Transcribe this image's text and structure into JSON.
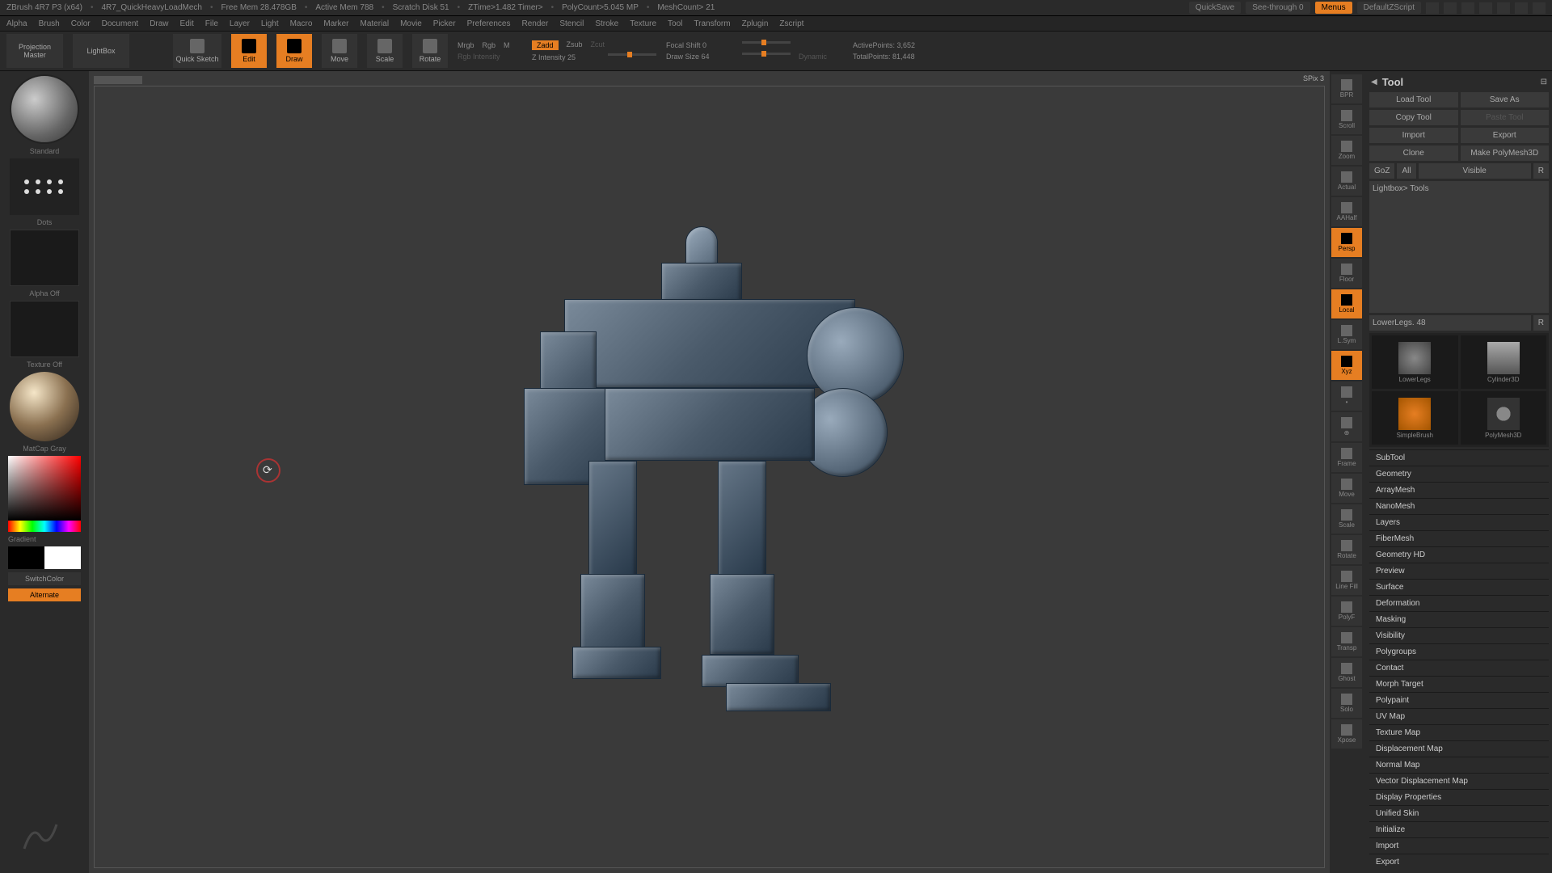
{
  "titlebar": {
    "app": "ZBrush 4R7 P3 (x64)",
    "doc": "4R7_QuickHeavyLoadMech",
    "stats": [
      "Free Mem 28.478GB",
      "Active Mem 788",
      "Scratch Disk 51",
      "ZTime>1.482 Timer>",
      "PolyCount>5.045 MP",
      "MeshCount> 21"
    ],
    "quicksave": "QuickSave",
    "seethrough": "See-through   0",
    "menus": "Menus",
    "script": "DefaultZScript"
  },
  "menus": [
    "Alpha",
    "Brush",
    "Color",
    "Document",
    "Draw",
    "Edit",
    "File",
    "Layer",
    "Light",
    "Macro",
    "Marker",
    "Material",
    "Movie",
    "Picker",
    "Preferences",
    "Render",
    "Stencil",
    "Stroke",
    "Texture",
    "Tool",
    "Transform",
    "Zplugin",
    "Zscript"
  ],
  "topshelf": {
    "projection": "Projection\nMaster",
    "lightbox": "LightBox",
    "quicksketch": "Quick\nSketch",
    "edit": "Edit",
    "draw": "Draw",
    "move": "Move",
    "scale": "Scale",
    "rotate": "Rotate",
    "mrgb": "Mrgb",
    "rgb": "Rgb",
    "m": "M",
    "rgbint": "Rgb Intensity",
    "zadd": "Zadd",
    "zsub": "Zsub",
    "zcut": "Zcut",
    "zint": "Z Intensity 25",
    "focal": "Focal Shift 0",
    "drawsize": "Draw Size 64",
    "dynamic": "Dynamic",
    "active": "ActivePoints: 3,652",
    "total": "TotalPoints: 81,448"
  },
  "left": {
    "brush": "Standard",
    "stroke": "Dots",
    "alpha": "Alpha Off",
    "texture": "Texture Off",
    "material": "MatCap Gray",
    "gradient": "Gradient",
    "switch": "SwitchColor",
    "alternate": "Alternate"
  },
  "rightIcons": [
    "BPR",
    "Scroll",
    "Zoom",
    "Actual",
    "AAHalf",
    "Persp",
    "Floor",
    "Local",
    "L.Sym",
    "Xyz",
    "•",
    "⊕",
    "Frame",
    "Move",
    "Scale",
    "Rotate",
    "Line Fill",
    "PolyF",
    "Transp",
    "Ghost",
    "Solo",
    "Xpose"
  ],
  "activeRightIcons": [
    "Persp",
    "Local",
    "Xyz"
  ],
  "tool": {
    "title": "Tool",
    "spix": "SPix 3",
    "load": "Load Tool",
    "save": "Save As",
    "copy": "Copy Tool",
    "paste": "Paste Tool",
    "import": "Import",
    "export": "Export",
    "clone": "Clone",
    "make": "Make PolyMesh3D",
    "goz": "GoZ",
    "all": "All",
    "visible": "Visible",
    "r": "R",
    "lightbox": "Lightbox> Tools",
    "name": "LowerLegs. 48",
    "thumbs": [
      "LowerLegs",
      "Cylinder3D",
      "SimpleBrush",
      "PolyMesh3D",
      "LowerLegs"
    ],
    "sections": [
      "SubTool",
      "Geometry",
      "ArrayMesh",
      "NanoMesh",
      "Layers",
      "FiberMesh",
      "Geometry HD",
      "Preview",
      "Surface",
      "Deformation",
      "Masking",
      "Visibility",
      "Polygroups",
      "Contact",
      "Morph Target",
      "Polypaint",
      "UV Map",
      "Texture Map",
      "Displacement Map",
      "Normal Map",
      "Vector Displacement Map",
      "Display Properties",
      "Unified Skin",
      "Initialize",
      "Import",
      "Export"
    ]
  }
}
